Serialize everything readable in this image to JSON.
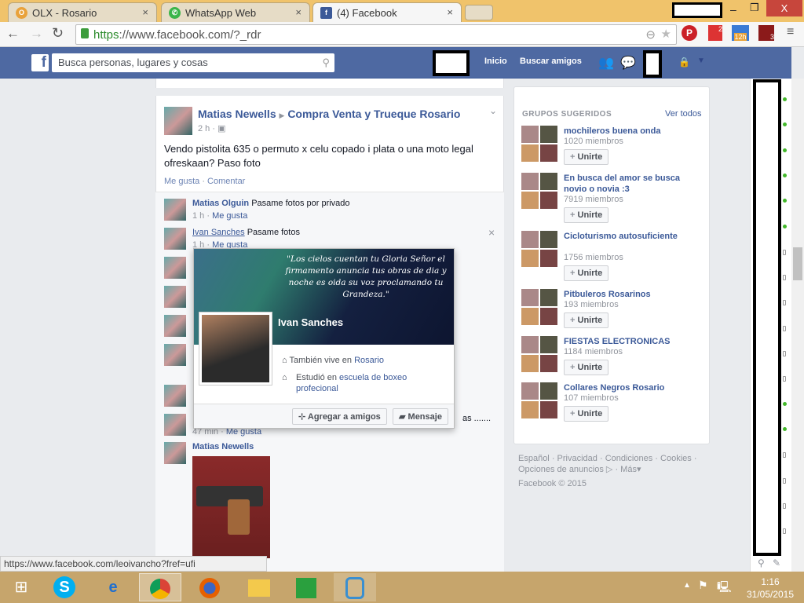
{
  "browser": {
    "tabs": [
      {
        "label": "OLX - Rosario",
        "icon": "olx-icon"
      },
      {
        "label": "WhatsApp Web",
        "icon": "whatsapp-icon"
      },
      {
        "label": "(4) Facebook",
        "icon": "facebook-icon"
      }
    ],
    "url_scheme": "https",
    "url_rest": "://www.facebook.com/?_rdr",
    "ext_badges": [
      "2",
      "12h",
      "3"
    ]
  },
  "fb_header": {
    "search_placeholder": "Busca personas, lugares y cosas",
    "home": "Inicio",
    "find_friends": "Buscar amigos"
  },
  "post": {
    "author": "Matias Newells",
    "group": "Compra Venta y Trueque Rosario",
    "time": "2 h",
    "text": "Vendo pistolita 635 o permuto x celu copado i plata o una moto legal ofreskaan? Paso foto",
    "like": "Me gusta",
    "comment": "Comentar"
  },
  "comments": [
    {
      "author": "Matias Olguin",
      "text": "Pasame fotos por privado",
      "time": "1 h",
      "like": "Me gusta"
    },
    {
      "author": "Ivan Sanches",
      "text": "Pasame fotos",
      "time": "1 h",
      "like": "Me gusta"
    },
    {
      "partial_text": "as .......",
      "time": "47 min",
      "like": "Me gusta"
    },
    {
      "author": "Matias Newells"
    }
  ],
  "hovercard": {
    "name": "Ivan Sanches",
    "cover_quote": "\"Los cielos cuentan tu Gloria Señor el firmamento anuncia tus obras de dia y noche es oida su voz proclamando tu Grandeza.\"",
    "lives_prefix": "También vive en",
    "lives_place": "Rosario",
    "studied_prefix": "Estudió en",
    "studied_place": "escuela de boxeo profecional",
    "add_friend": "Agregar a amigos",
    "message": "Mensaje"
  },
  "groups": {
    "title": "GRUPOS SUGERIDOS",
    "see_all": "Ver todos",
    "join": "Unirte",
    "items": [
      {
        "name": "mochileros buena onda",
        "members": "1020 miembros"
      },
      {
        "name": "En busca del amor se busca novio o novia :3",
        "members": "7919 miembros"
      },
      {
        "name": "Cicloturismo autosuficiente",
        "members": "1756 miembros"
      },
      {
        "name": "Pitbuleros Rosarinos",
        "members": "193 miembros"
      },
      {
        "name": "FIESTAS ELECTRONICAS",
        "members": "1184 miembros"
      },
      {
        "name": "Collares Negros Rosario",
        "members": "107 miembros"
      }
    ]
  },
  "footer": {
    "links": [
      "Español",
      "Privacidad",
      "Condiciones",
      "Cookies",
      "Opciones de anuncios",
      "Más"
    ],
    "copyright": "Facebook © 2015"
  },
  "status_url": "https://www.facebook.com/leoivancho?fref=ufi",
  "clock": {
    "time": "1:16",
    "date": "31/05/2015"
  }
}
